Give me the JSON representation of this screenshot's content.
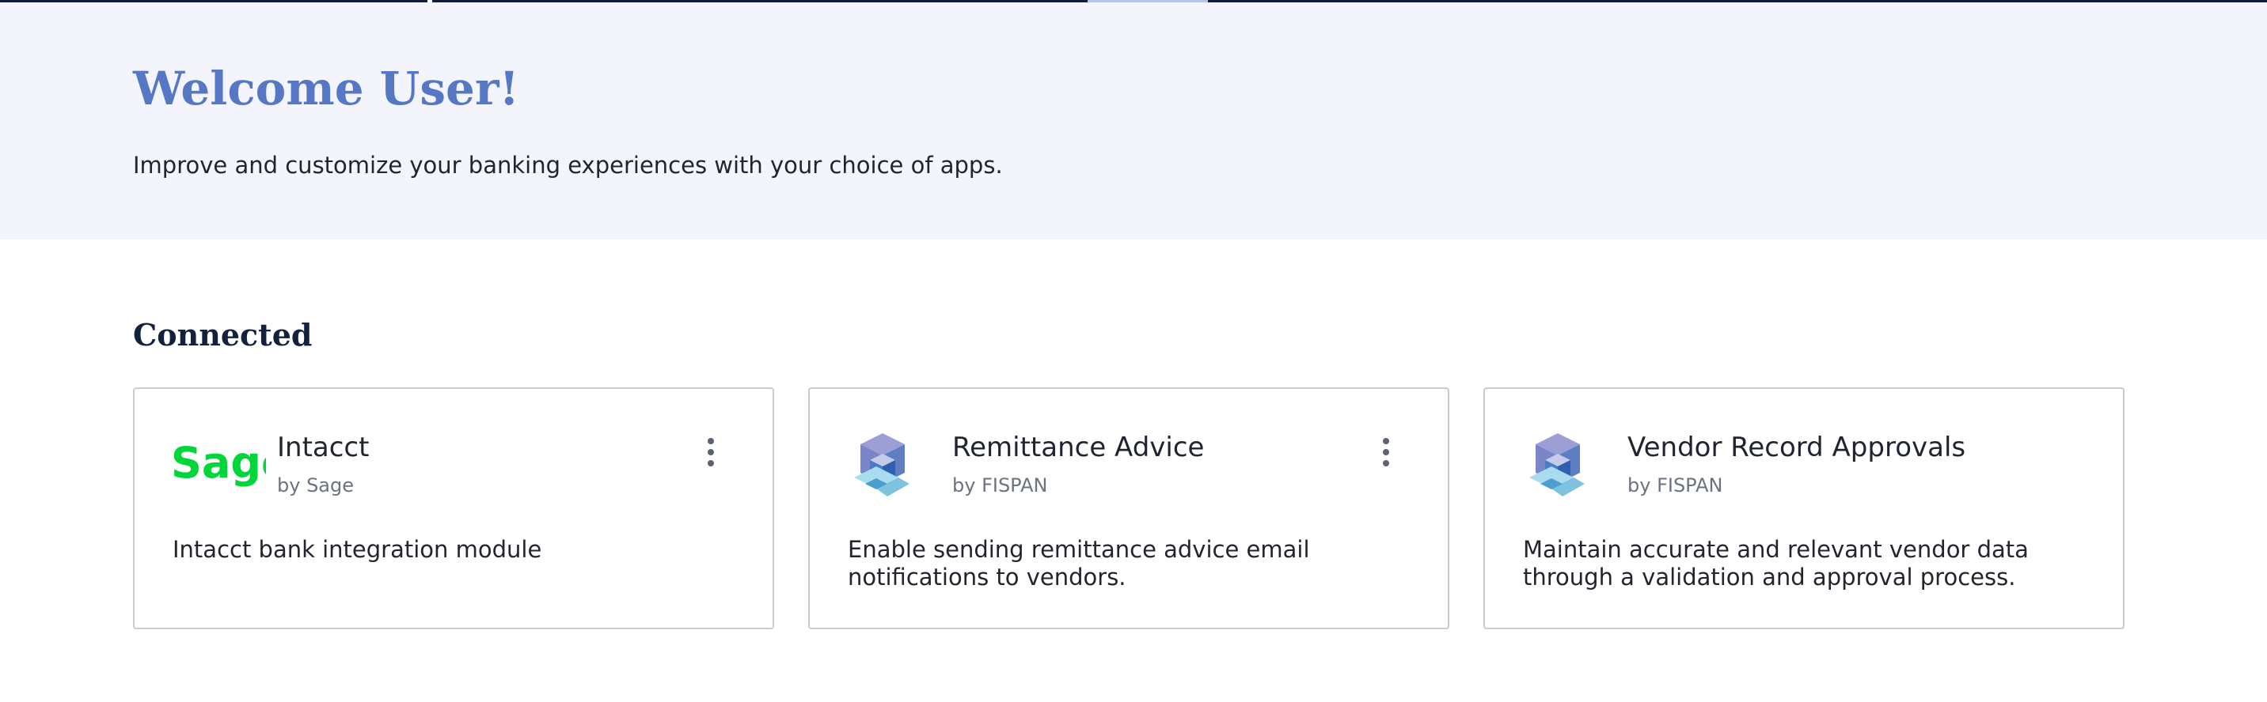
{
  "hero": {
    "title": "Welcome User!",
    "subtitle": "Improve and customize your banking experiences with your choice of apps."
  },
  "section": {
    "title": "Connected"
  },
  "cards": [
    {
      "name": "Intacct",
      "vendor": "by Sage",
      "description": "Intacct bank integration module",
      "logo_text": "Sage",
      "logo_icon": "sage-logo",
      "has_menu": true
    },
    {
      "name": "Remittance Advice",
      "vendor": "by FISPAN",
      "description": "Enable sending remittance advice email notifications to vendors.",
      "logo_icon": "fispan-cube-logo",
      "has_menu": true
    },
    {
      "name": "Vendor Record Approvals",
      "vendor": "by FISPAN",
      "description": "Maintain accurate and relevant vendor data through a validation and approval process.",
      "logo_icon": "fispan-cube-logo",
      "has_menu": false
    }
  ],
  "colors": {
    "hero_background": "#f4f5fc",
    "hero_title": "#5677c4",
    "section_title": "#14213d",
    "sage_green": "#00d639",
    "card_border": "#c9cbd1"
  }
}
